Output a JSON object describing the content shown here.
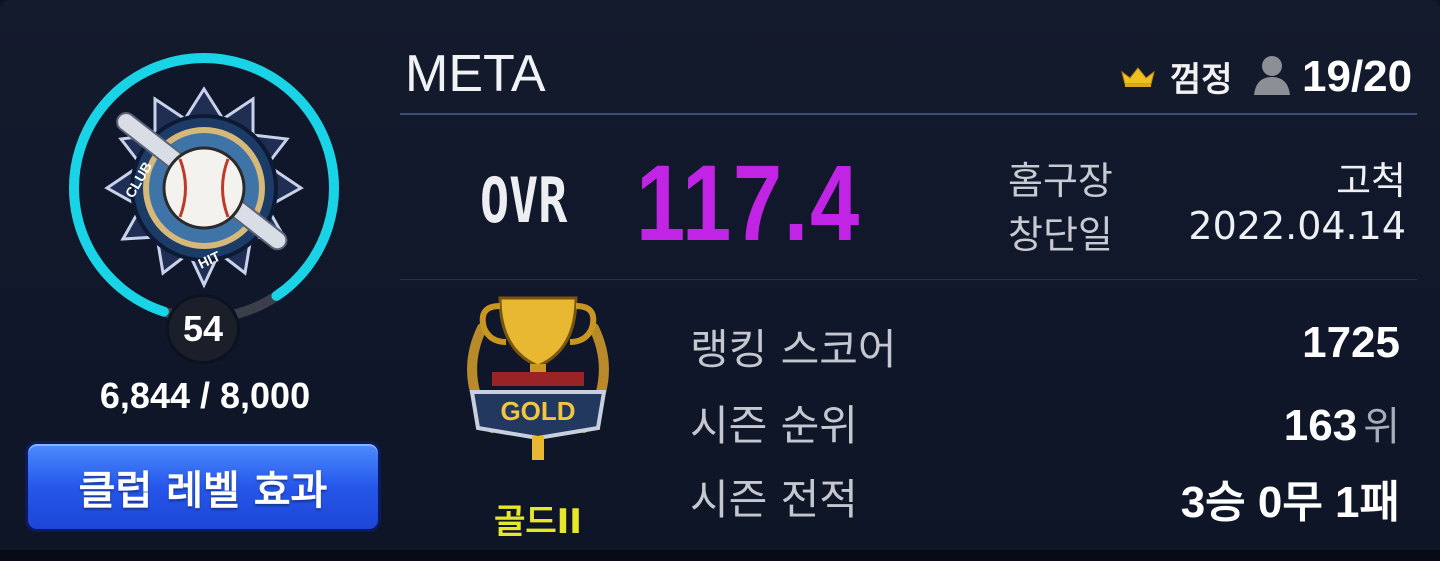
{
  "club": {
    "name": "META",
    "emblem_icon": "club-hit-baseball-emblem",
    "level": "54",
    "exp": "6,844 / 8,000",
    "exp_progress": 0.8555,
    "effect_button_label": "클럽 레벨 효과"
  },
  "header": {
    "owner_icon": "crown-icon",
    "owner_name": "껌정",
    "member_icon": "person-icon",
    "member_count": "19/20"
  },
  "ovr": {
    "label": "OVR",
    "value": "117.4"
  },
  "info": {
    "stadium_label": "홈구장",
    "stadium_value": "고척",
    "founded_label": "창단일",
    "founded_value": "2022.04.14"
  },
  "tier": {
    "icon": "gold-trophy-icon",
    "badge_text": "GOLD",
    "label": "골드II"
  },
  "stats": {
    "rank_score_label": "랭킹 스코어",
    "rank_score_value": "1725",
    "season_rank_label": "시즌 순위",
    "season_rank_value": "163",
    "season_rank_unit": "위",
    "season_record_label": "시즌 전적",
    "season_record_value": "3승 0무 1패"
  },
  "colors": {
    "accent_ovr": "#c224e6",
    "progress_ring": "#19d3e6",
    "tier_gold": "#e6e62a",
    "button_blue": "#2557ea"
  }
}
